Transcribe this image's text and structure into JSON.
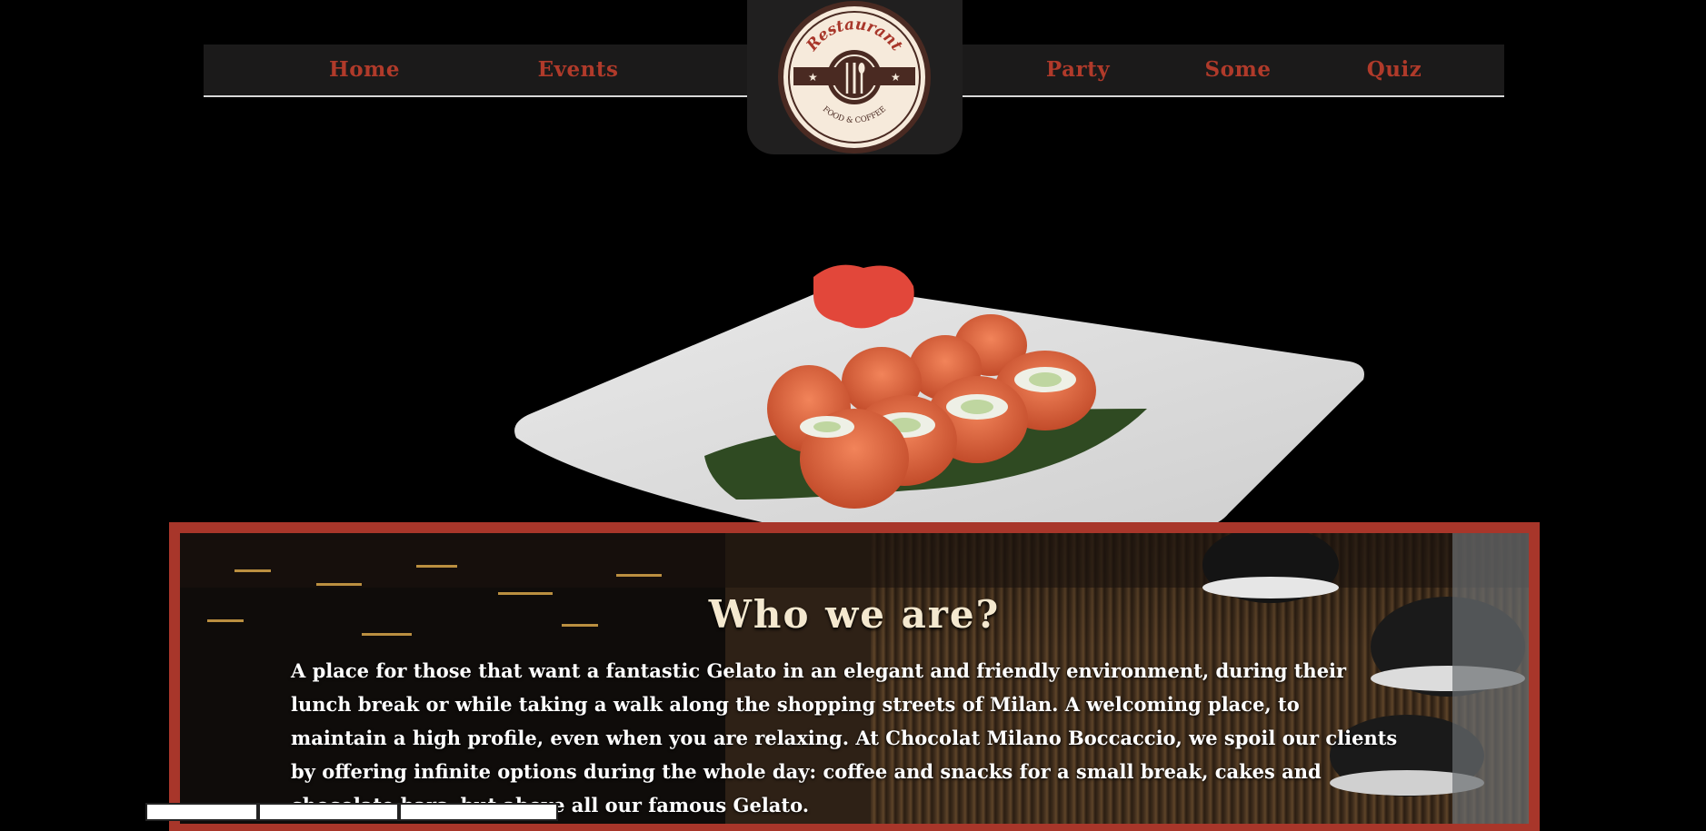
{
  "nav": {
    "items": [
      {
        "label": "Home"
      },
      {
        "label": "Events"
      },
      {
        "label": "Party"
      },
      {
        "label": "Some"
      },
      {
        "label": "Quiz"
      }
    ]
  },
  "logo": {
    "title": "Restaurant",
    "subtitle": "FOOD & COFFEE"
  },
  "about": {
    "title": "Who we are?",
    "text": "A place for those that want a fantastic Gelato in an elegant and friendly environment, during their lunch break or while taking a walk along the shopping streets of Milan. A welcoming place, to maintain a high profile, even when you are relaxing. At Chocolat Milano Boccaccio, we spoil our clients by offering infinite options during the whole day: coffee and snacks for a small break, cakes and chocolate bars, but above all our famous Gelato."
  },
  "colors": {
    "accent": "#b03a2a",
    "frame": "#a8362a",
    "nav_bg": "#1b1a1a",
    "logo_cream": "#f6eadb",
    "logo_brown": "#4a2a22"
  },
  "icons": [
    "restaurant-logo-icon",
    "fork-knife-spoon-icon",
    "star-icon"
  ]
}
